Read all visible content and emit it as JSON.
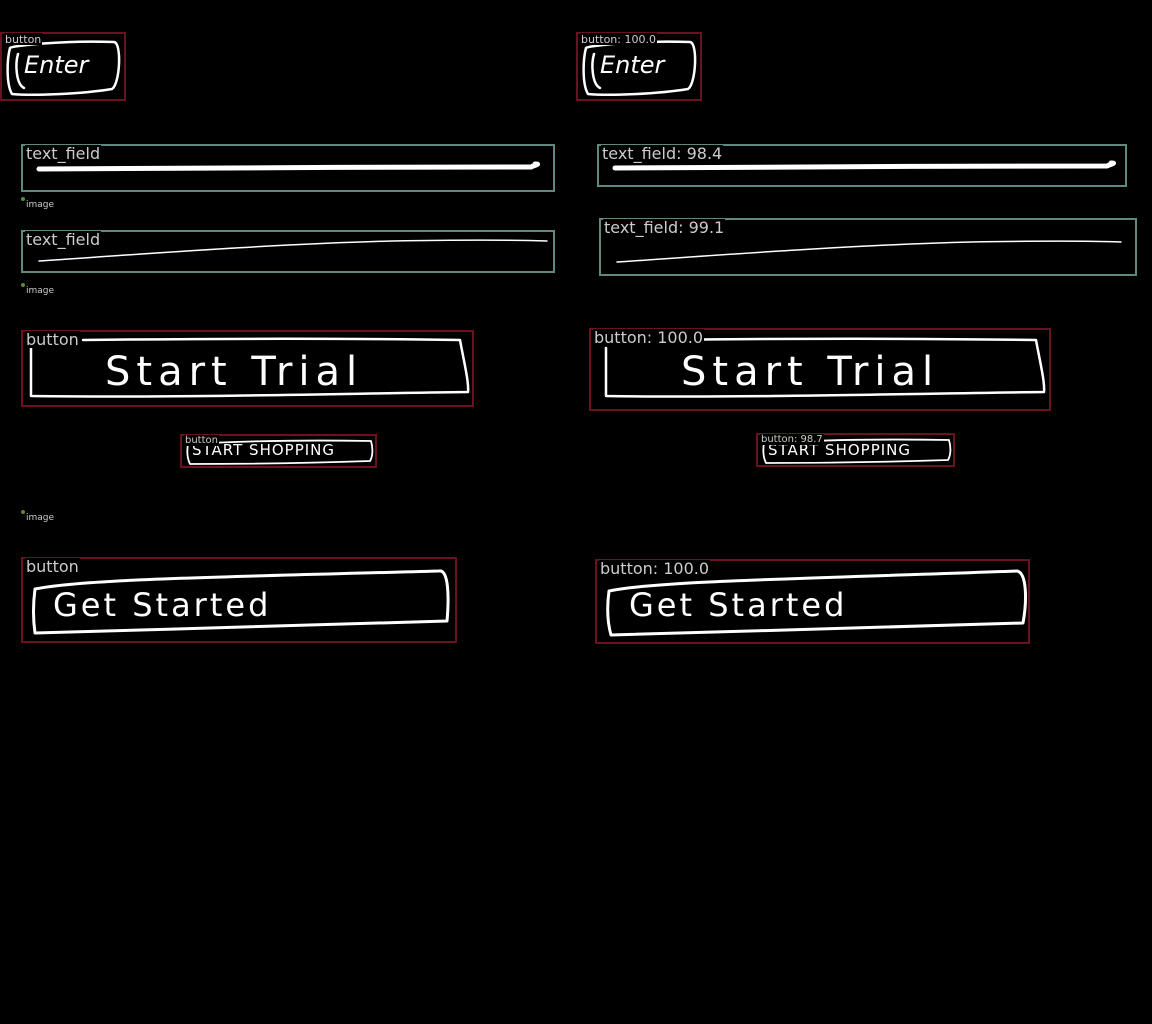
{
  "left_panel": {
    "enter_button": {
      "label": "button",
      "text": "Enter"
    },
    "text_field_1": {
      "label": "text_field"
    },
    "image_1": {
      "label": "image"
    },
    "text_field_2": {
      "label": "text_field"
    },
    "image_2": {
      "label": "image"
    },
    "start_trial_button": {
      "label": "button",
      "text": "Start Trial"
    },
    "start_shopping_button": {
      "label": "button",
      "text": "START SHOPPING"
    },
    "image_3": {
      "label": "image"
    },
    "get_started_button": {
      "label": "button",
      "text": "Get Started"
    }
  },
  "right_panel": {
    "enter_button": {
      "label": "button: 100.0",
      "text": "Enter"
    },
    "text_field_1": {
      "label": "text_field: 98.4"
    },
    "text_field_2": {
      "label": "text_field: 99.1"
    },
    "start_trial_button": {
      "label": "button: 100.0",
      "text": "Start Trial"
    },
    "start_shopping_button": {
      "label": "button: 98.7",
      "text": "START SHOPPING"
    },
    "get_started_button": {
      "label": "button: 100.0",
      "text": "Get Started"
    }
  },
  "colors": {
    "background": "#000000",
    "button_box": "#6a1220",
    "text_field_box": "#5f8880",
    "label_text": "#cccccc",
    "image_dot": "#5a8a3a",
    "sketch_stroke": "#ffffff"
  }
}
